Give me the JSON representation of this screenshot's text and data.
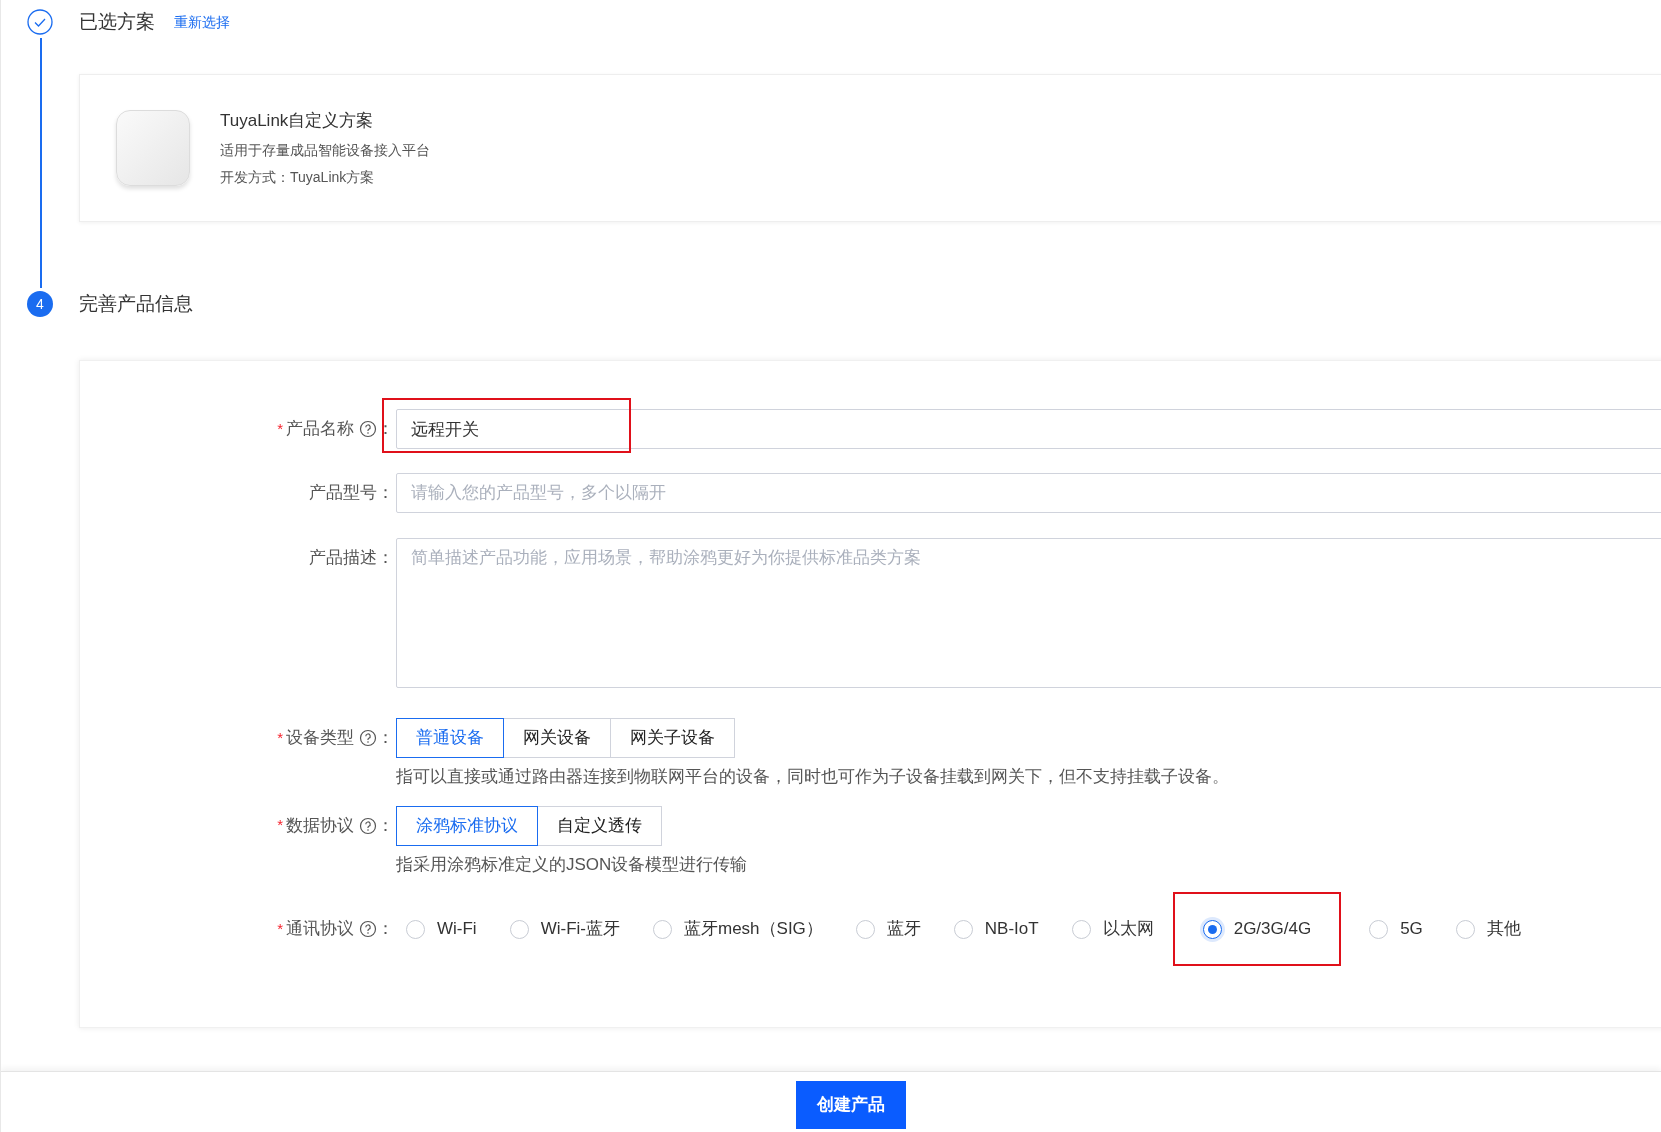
{
  "steps": [
    {
      "kind": "done",
      "title": "已选方案",
      "link": "重新选择"
    },
    {
      "kind": "active",
      "number": "4",
      "title": "完善产品信息"
    }
  ],
  "solution": {
    "title": "TuyaLink自定义方案",
    "description": "适用于存量成品智能设备接入平台",
    "method": "开发方式：TuyaLink方案"
  },
  "form": {
    "name": {
      "required_mark": "*",
      "label": "产品名称",
      "help": true,
      "suffix": "：",
      "value": "远程开关",
      "highlighted": true
    },
    "model": {
      "label": "产品型号",
      "suffix": "：",
      "placeholder": "请输入您的产品型号，多个以隔开"
    },
    "description": {
      "label": "产品描述",
      "suffix": "：",
      "placeholder": "简单描述产品功能，应用场景，帮助涂鸦更好为你提供标准品类方案"
    },
    "device_type": {
      "required_mark": "*",
      "label": "设备类型",
      "help": true,
      "suffix": "：",
      "options": [
        {
          "label": "普通设备",
          "selected": true
        },
        {
          "label": "网关设备",
          "selected": false
        },
        {
          "label": "网关子设备",
          "selected": false
        }
      ],
      "hint": "指可以直接或通过路由器连接到物联网平台的设备，同时也可作为子设备挂载到网关下，但不支持挂载子设备。"
    },
    "data_protocol": {
      "required_mark": "*",
      "label": "数据协议",
      "help": true,
      "suffix": "：",
      "options": [
        {
          "label": "涂鸦标准协议",
          "selected": true
        },
        {
          "label": "自定义透传",
          "selected": false
        }
      ],
      "hint": "指采用涂鸦标准定义的JSON设备模型进行传输"
    },
    "comm_protocol": {
      "required_mark": "*",
      "label": "通讯协议",
      "help": true,
      "suffix": "：",
      "options": [
        {
          "label": "Wi-Fi",
          "selected": false,
          "highlighted": false
        },
        {
          "label": "Wi-Fi-蓝牙",
          "selected": false,
          "highlighted": false
        },
        {
          "label": "蓝牙mesh（SIG）",
          "selected": false,
          "highlighted": false
        },
        {
          "label": "蓝牙",
          "selected": false,
          "highlighted": false
        },
        {
          "label": "NB-IoT",
          "selected": false,
          "highlighted": false
        },
        {
          "label": "以太网",
          "selected": false,
          "highlighted": false
        },
        {
          "label": "2G/3G/4G",
          "selected": true,
          "highlighted": true
        },
        {
          "label": "5G",
          "selected": false,
          "highlighted": false
        },
        {
          "label": "其他",
          "selected": false,
          "highlighted": false
        }
      ]
    }
  },
  "submit_button": "创建产品"
}
